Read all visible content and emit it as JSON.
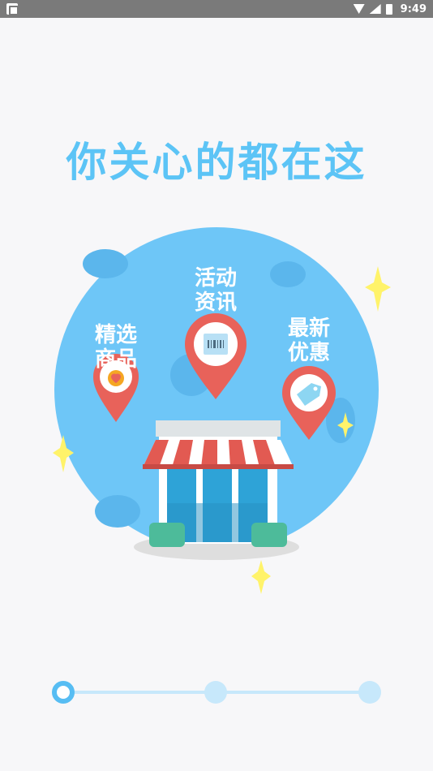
{
  "status_bar": {
    "time": "9:49"
  },
  "headline": "你关心的都在这",
  "pins": [
    {
      "line1": "精选",
      "line2": "商品",
      "icon": "heart-gift-icon"
    },
    {
      "line1": "活动",
      "line2": "资讯",
      "icon": "barcode-card-icon"
    },
    {
      "line1": "最新",
      "line2": "优惠",
      "icon": "price-tag-icon"
    }
  ],
  "pager": {
    "count": 3,
    "active_index": 0
  },
  "colors": {
    "accent": "#5cc4f6",
    "circle": "#6ec6f7",
    "pin": "#e8625a",
    "awning_red": "#e25a52",
    "door": "#2ea3d7",
    "bench": "#4dbb9a",
    "sparkle": "#fff36a"
  }
}
